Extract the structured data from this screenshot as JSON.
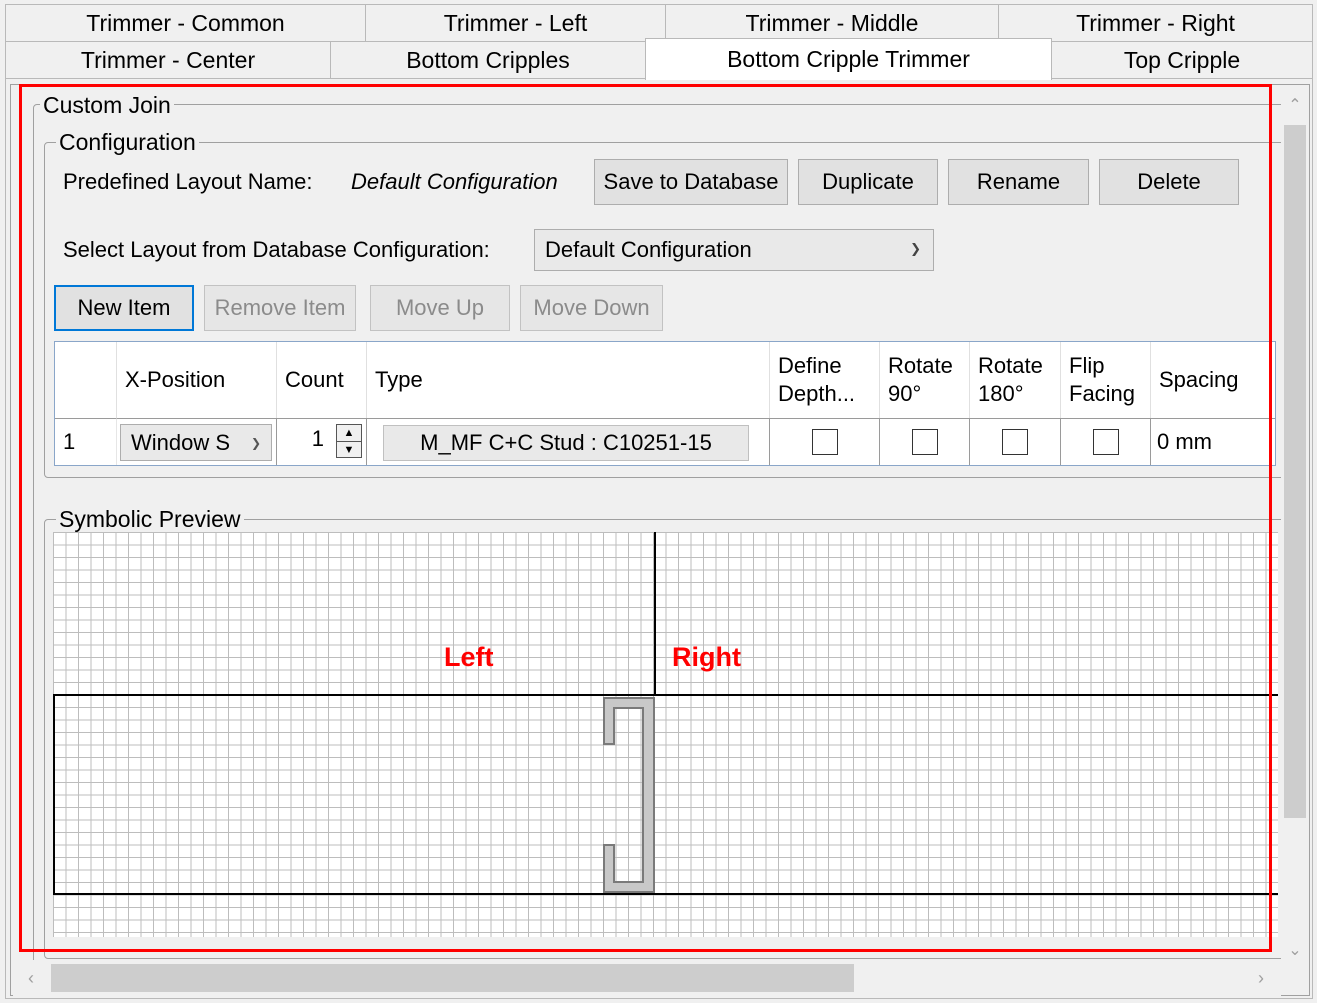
{
  "tabs_row1": [
    "Trimmer - Common",
    "Trimmer - Left",
    "Trimmer - Middle",
    "Trimmer - Right"
  ],
  "tabs_row2": [
    "Trimmer - Center",
    "Bottom Cripples",
    "Bottom Cripple Trimmer",
    "Top Cripple"
  ],
  "active_tab": "Bottom Cripple Trimmer",
  "custom_join": {
    "legend": "Custom Join",
    "configuration": {
      "legend": "Configuration",
      "predefined_label": "Predefined Layout Name:",
      "predefined_value": "Default Configuration",
      "save_label": "Save to Database",
      "duplicate_label": "Duplicate",
      "rename_label": "Rename",
      "delete_label": "Delete",
      "select_label": "Select Layout from Database Configuration:",
      "select_value": "Default Configuration",
      "new_item_label": "New Item",
      "remove_item_label": "Remove Item",
      "move_up_label": "Move Up",
      "move_down_label": "Move Down",
      "grid": {
        "headers": {
          "x_position": "X-Position",
          "count": "Count",
          "type": "Type",
          "define_depth_1": "Define",
          "define_depth_2": "Depth...",
          "rotate90_1": "Rotate",
          "rotate90_2": "90°",
          "rotate180_1": "Rotate",
          "rotate180_2": "180°",
          "flip_1": "Flip",
          "flip_2": "Facing",
          "spacing": "Spacing"
        },
        "rows": [
          {
            "index": "1",
            "x_position": "Window S",
            "count": "1",
            "type": "M_MF C+C Stud : C10251-15",
            "define_depth": false,
            "rotate90": false,
            "rotate180": false,
            "flip_facing": false,
            "spacing": "0 mm"
          }
        ]
      }
    },
    "preview": {
      "legend": "Symbolic Preview",
      "left_label": "Left",
      "right_label": "Right",
      "label_color": "#ff0000"
    }
  },
  "icons": [
    "chevron-down-icon",
    "spinner-up-icon",
    "spinner-down-icon",
    "scroll-up-icon",
    "scroll-down-icon",
    "scroll-left-icon",
    "scroll-right-icon"
  ]
}
